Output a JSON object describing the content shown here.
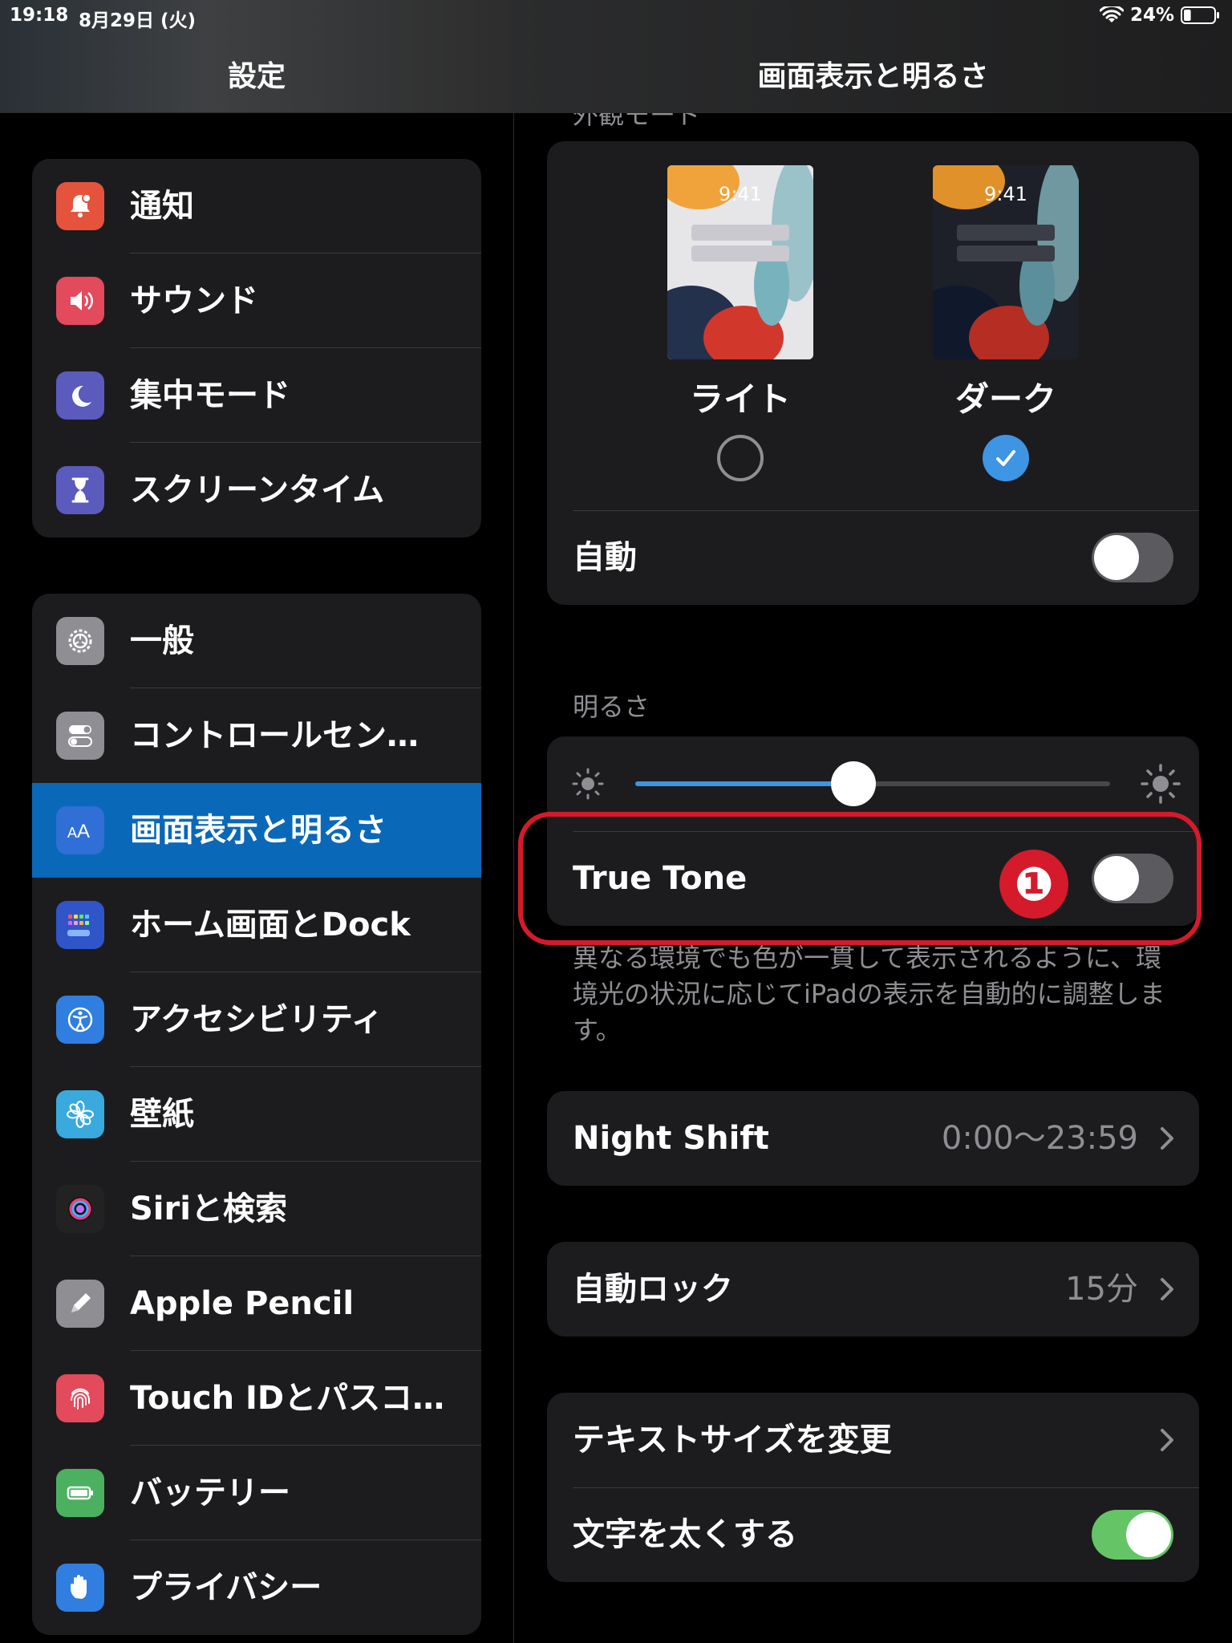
{
  "status_bar": {
    "time": "19:18",
    "date": "8月29日 (火)",
    "battery": "24%",
    "battery_level": 0.24
  },
  "sidebar": {
    "title": "設定",
    "groups": [
      [
        {
          "label": "通知",
          "icon": "bell-icon",
          "color": "#e5533d"
        },
        {
          "label": "サウンド",
          "icon": "speaker-icon",
          "color": "#e34a5c"
        },
        {
          "label": "集中モード",
          "icon": "moon-icon",
          "color": "#5a5bbd"
        },
        {
          "label": "スクリーンタイム",
          "icon": "hourglass-icon",
          "color": "#5a5bbd"
        }
      ],
      [
        {
          "label": "一般",
          "icon": "gear-icon",
          "color": "#8e8e93"
        },
        {
          "label": "コントロールセン…",
          "icon": "toggles-icon",
          "color": "#8e8e93"
        },
        {
          "label": "画面表示と明るさ",
          "icon": "text-size-icon",
          "color": "#2f6fd6",
          "selected": true
        },
        {
          "label": "ホーム画面とDock",
          "icon": "home-grid-icon",
          "color": "#2f55c8"
        },
        {
          "label": "アクセシビリティ",
          "icon": "accessibility-icon",
          "color": "#2f7ee0"
        },
        {
          "label": "壁紙",
          "icon": "flower-icon",
          "color": "#39a9de"
        },
        {
          "label": "Siriと検索",
          "icon": "siri-icon",
          "color": "#222222"
        },
        {
          "label": "Apple Pencil",
          "icon": "pencil-icon",
          "color": "#8e8e93"
        },
        {
          "label": "Touch IDとパスコ…",
          "icon": "fingerprint-icon",
          "color": "#e34a5c"
        },
        {
          "label": "バッテリー",
          "icon": "battery-icon",
          "color": "#4cb061"
        },
        {
          "label": "プライバシー",
          "icon": "hand-icon",
          "color": "#2f7ee0"
        }
      ]
    ]
  },
  "detail": {
    "title": "画面表示と明るさ",
    "appearance": {
      "section_label": "外観モード",
      "light_time": "9:41",
      "dark_time": "9:41",
      "light_label": "ライト",
      "dark_label": "ダーク",
      "selected": "dark",
      "auto_label": "自動",
      "auto_on": false
    },
    "brightness": {
      "section_label": "明るさ",
      "level": 0.46,
      "true_tone_label": "True Tone",
      "true_tone_on": false,
      "badge": "❶",
      "footer": "異なる環境でも色が一貫して表示されるように、環境光の状況に応じてiPadの表示を自動的に調整します。"
    },
    "night_shift": {
      "label": "Night Shift",
      "value": "0:00〜23:59"
    },
    "auto_lock": {
      "label": "自動ロック",
      "value": "15分"
    },
    "text": {
      "text_size_label": "テキストサイズを変更",
      "bold_text_label": "文字を太くする",
      "bold_text_on": true
    }
  },
  "colors": {
    "accent": "#3d95e4",
    "selected_row": "#0a68b8",
    "highlight": "#d51a2b",
    "toggle_on": "#65c466"
  }
}
